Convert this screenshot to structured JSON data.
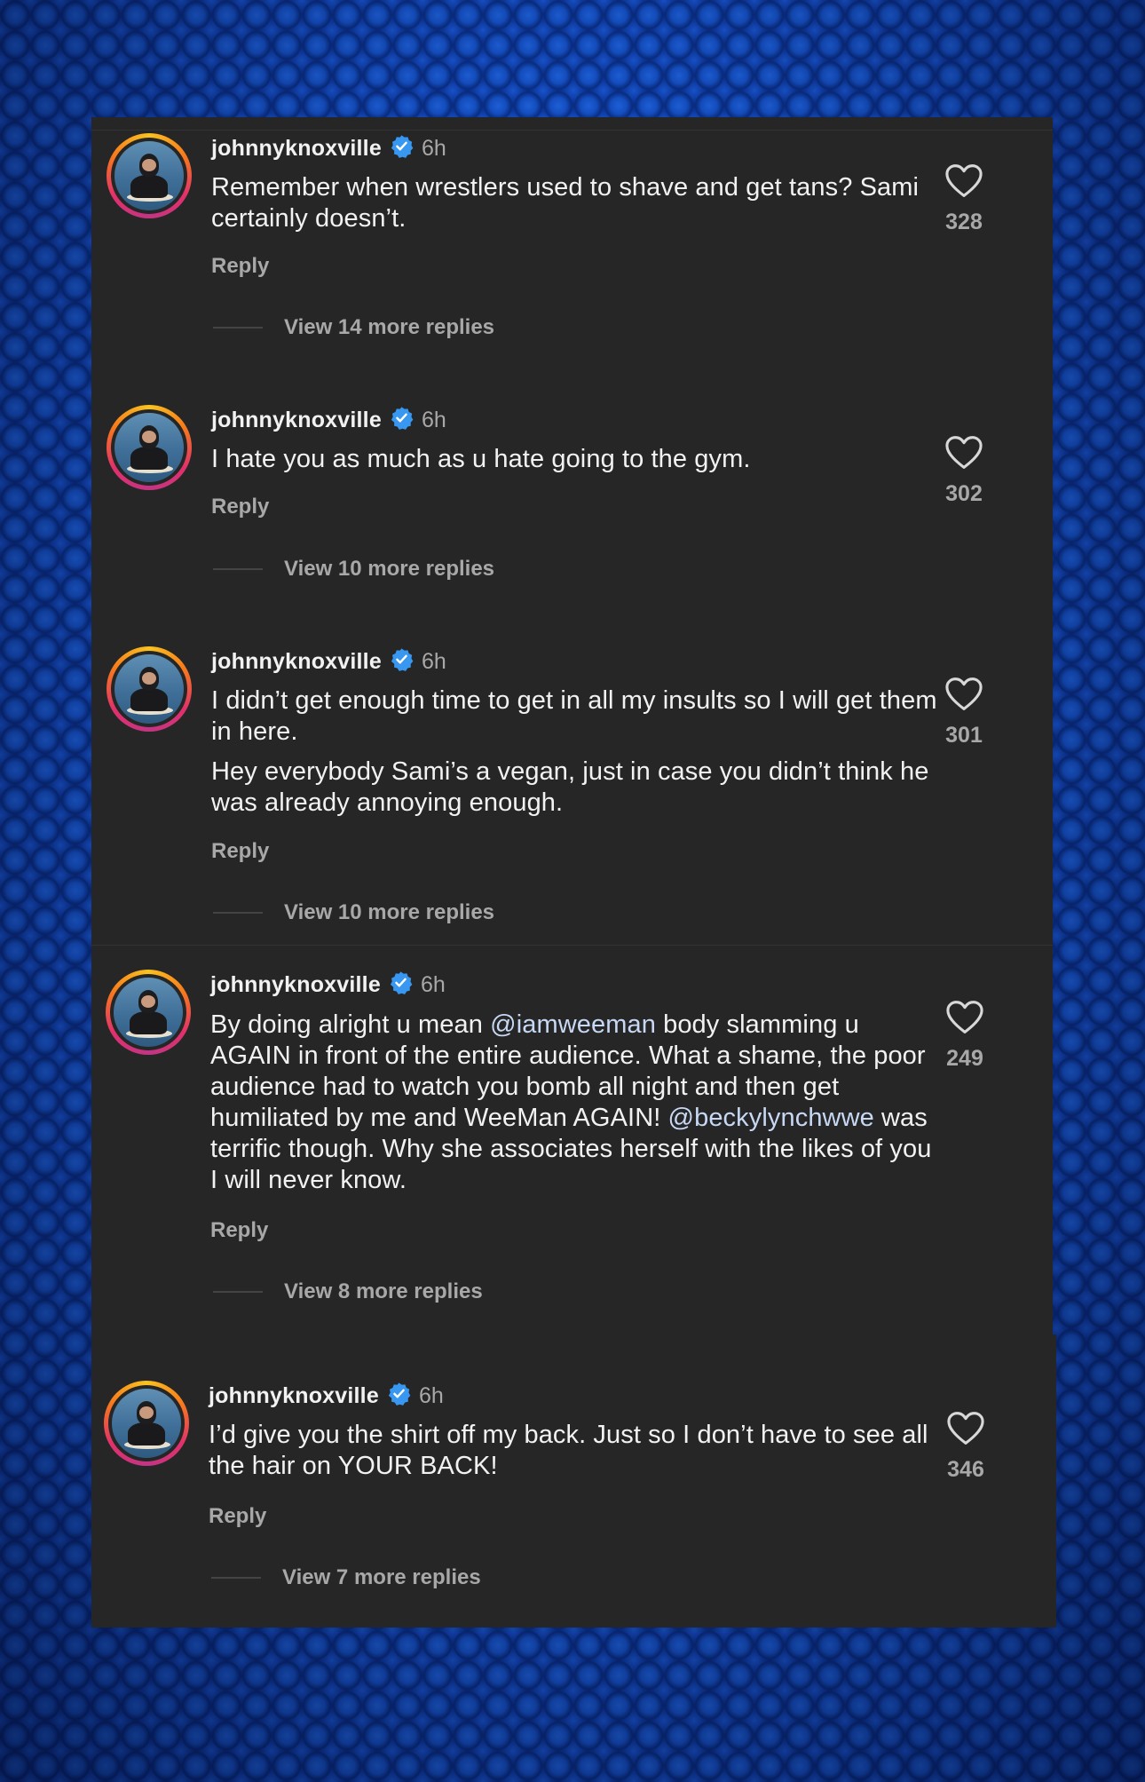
{
  "comments": [
    {
      "username": "johnnyknoxville",
      "time": "6h",
      "paragraphs": [
        [
          {
            "t": "Remember when wrestlers used to shave and get tans? Sami certainly doesn’t."
          }
        ]
      ],
      "reply_label": "Reply",
      "view_replies": "View 14 more replies",
      "likes": "328"
    },
    {
      "username": "johnnyknoxville",
      "time": "6h",
      "paragraphs": [
        [
          {
            "t": "I hate you as much as u hate going to the gym."
          }
        ]
      ],
      "reply_label": "Reply",
      "view_replies": "View 10 more replies",
      "likes": "302"
    },
    {
      "username": "johnnyknoxville",
      "time": "6h",
      "paragraphs": [
        [
          {
            "t": "I didn’t get enough time to get in all my insults so I will get them in here."
          }
        ],
        [
          {
            "t": "Hey everybody Sami’s a vegan, just in case you didn’t think he was already annoying enough."
          }
        ]
      ],
      "reply_label": "Reply",
      "view_replies": "View 10 more replies",
      "likes": "301"
    },
    {
      "username": "johnnyknoxville",
      "time": "6h",
      "paragraphs": [
        [
          {
            "t": "By doing alright u mean "
          },
          {
            "t": "@iamweeman",
            "mention": true
          },
          {
            "t": " body slamming u AGAIN in front of the entire audience. What a shame, the poor audience had to watch you bomb all night and then get humiliated by me and WeeMan AGAIN! "
          },
          {
            "t": "@beckylynchwwe",
            "mention": true
          },
          {
            "t": " was terrific though. Why she associates herself with the likes of you I will never know."
          }
        ]
      ],
      "reply_label": "Reply",
      "view_replies": "View 8 more replies",
      "likes": "249"
    },
    {
      "username": "johnnyknoxville",
      "time": "6h",
      "paragraphs": [
        [
          {
            "t": "I’d give you the shirt off my back. Just so I don’t have to see all the hair on YOUR BACK!"
          }
        ]
      ],
      "reply_label": "Reply",
      "view_replies": "View 7 more replies",
      "likes": "346"
    }
  ],
  "icons": {
    "verified": "verified-badge-icon",
    "like": "heart-outline-icon"
  },
  "colors": {
    "panel_bg": "#262626",
    "text": "#f2f2f2",
    "muted": "#a8a8a8",
    "mention": "#c7d8f5",
    "verified": "#3897f0",
    "background": "#0b2f8a"
  }
}
